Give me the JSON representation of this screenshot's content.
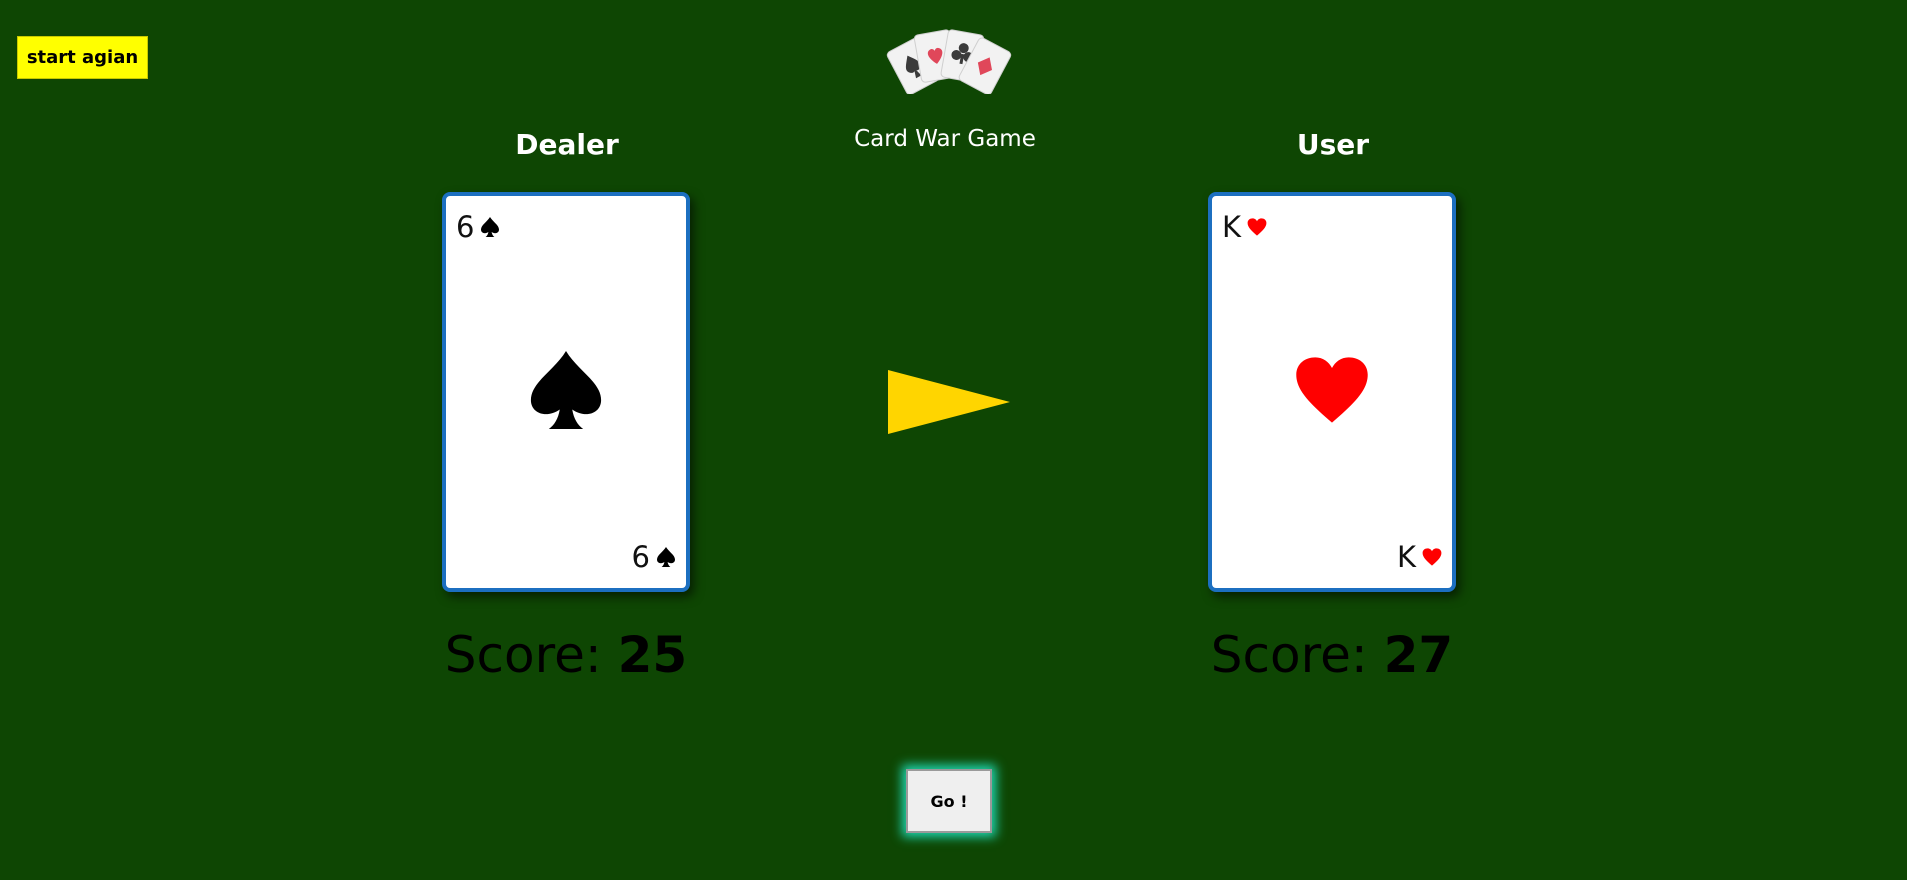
{
  "restart_button": {
    "label": "start agian"
  },
  "header": {
    "title": "Card War Game",
    "logo_icon": "playing-cards-icon"
  },
  "dealer": {
    "name": "Dealer",
    "card": {
      "rank": "6",
      "suit": "spades",
      "suit_color": "#000000"
    },
    "score_label": "Score:",
    "score": "25"
  },
  "user": {
    "name": "User",
    "card": {
      "rank": "K",
      "suit": "hearts",
      "suit_color": "#ff0000"
    },
    "score_label": "Score:",
    "score": "27"
  },
  "indicator": {
    "icon": "triangle-arrow-right-icon",
    "color": "#ffd500"
  },
  "go_button": {
    "label": "Go !"
  },
  "colors": {
    "table": "#0e4603",
    "card_border": "#1c6fc0",
    "restart_button": "#ffff00",
    "go_glow": "#1fd6b0"
  }
}
